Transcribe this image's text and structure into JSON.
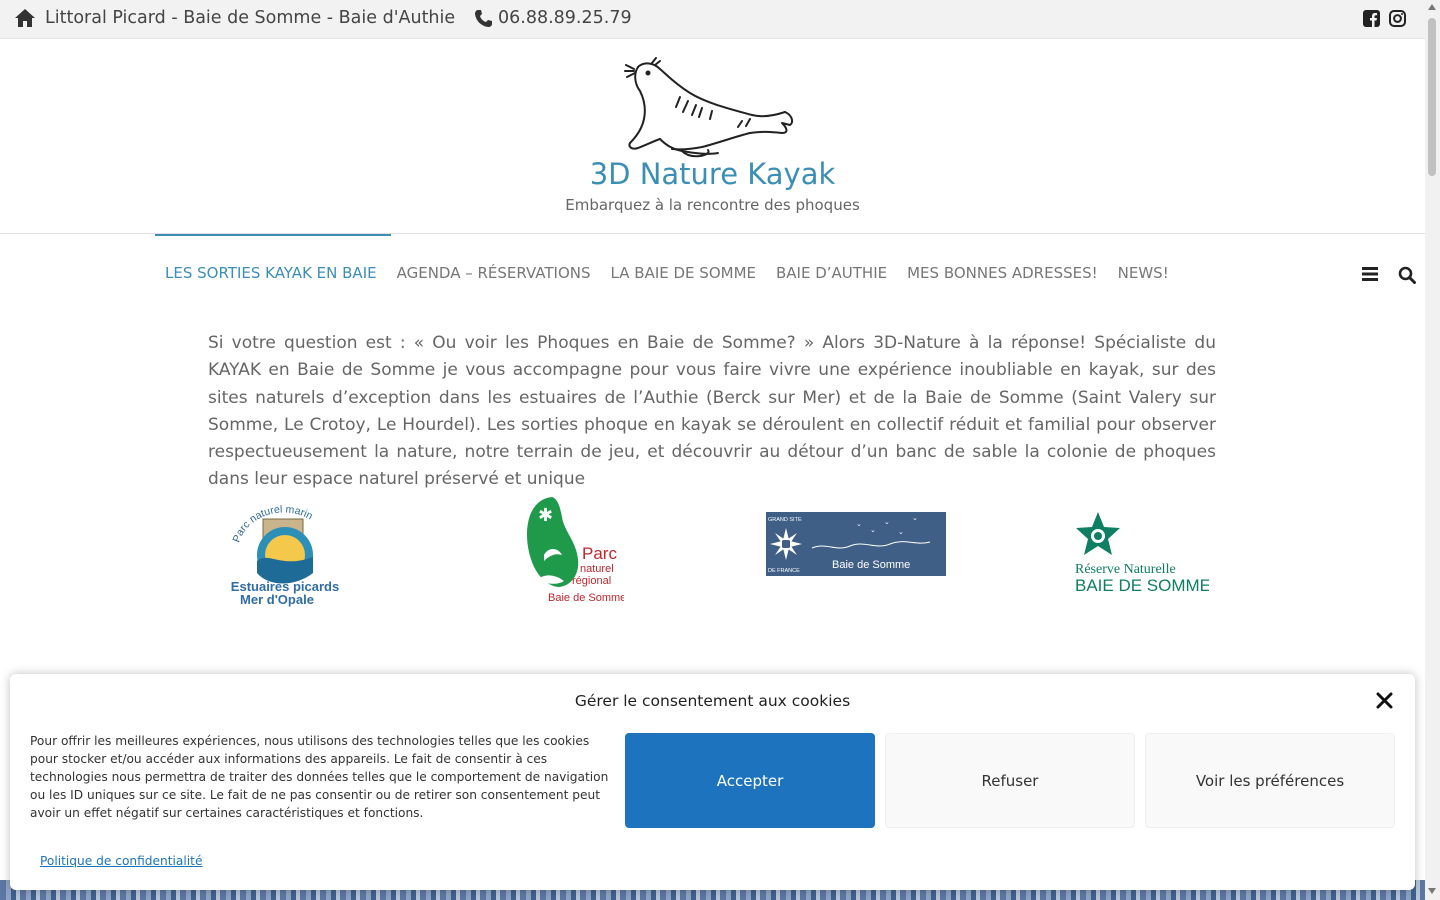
{
  "topbar": {
    "location": "Littoral Picard - Baie de Somme - Baie d'Authie",
    "phone": "06.88.89.25.79",
    "icons": [
      "home-icon",
      "phone-icon",
      "facebook-icon",
      "instagram-icon"
    ]
  },
  "header": {
    "title": "3D Nature Kayak",
    "tagline": "Embarquez à la rencontre des phoques",
    "logo": "seal-logo"
  },
  "nav": {
    "items": [
      {
        "label": "LES SORTIES KAYAK EN BAIE",
        "active": true
      },
      {
        "label": "AGENDA – RÉSERVATIONS",
        "active": false
      },
      {
        "label": "LA BAIE DE SOMME",
        "active": false
      },
      {
        "label": "BAIE D’AUTHIE",
        "active": false
      },
      {
        "label": "MES BONNES ADRESSES!",
        "active": false
      },
      {
        "label": "NEWS!",
        "active": false
      }
    ],
    "icons": [
      "menu-icon",
      "search-icon"
    ]
  },
  "intro": {
    "text": "Si votre question est : « Ou voir les Phoques en Baie de Somme? » Alors 3D-Nature à la réponse! Spécialiste du KAYAK en Baie de Somme je vous accompagne pour vous faire vivre une expérience inoubliable en kayak, sur des  sites naturels d’exception dans les estuaires de l’Authie (Berck sur Mer) et de la Baie de Somme (Saint Valery sur Somme, Le Crotoy, Le Hourdel). Les sorties phoque en kayak se déroulent en collectif réduit et familial pour observer respectueusement la nature, notre terrain de jeu, et découvrir au détour d’un banc de sable la colonie de phoques dans leur espace naturel préservé et unique"
  },
  "partners": {
    "pnm": {
      "arc": "Parc naturel marin",
      "line1": "Estuaires picards",
      "line2": "Mer d'Opale"
    },
    "pnr": {
      "line1": "Parc",
      "line2": "naturel",
      "line3": "régional",
      "line4": "Baie de Somme"
    },
    "grandsite": {
      "small1": "GRAND SITE",
      "small2": "DE FRANCE",
      "name": "Baie de Somme"
    },
    "reserve": {
      "line1": "Réserve Naturelle",
      "line2": "BAIE DE SOMME"
    }
  },
  "cookie": {
    "title": "Gérer le consentement aux cookies",
    "message": "Pour offrir les meilleures expériences, nous utilisons des technologies telles que les cookies pour stocker et/ou accéder aux informations des appareils. Le fait de consentir à ces technologies nous permettra de traiter des données telles que le comportement de navigation ou les ID uniques sur ce site. Le fait de ne pas consentir ou de retirer son consentement peut avoir un effet négatif sur certaines caractéristiques et fonctions.",
    "accept": "Accepter",
    "refuse": "Refuser",
    "preferences": "Voir les préférences",
    "privacy_link": "Politique de confidentialité"
  },
  "colors": {
    "brand": "#3b8fb7",
    "accept_button": "#1e73be",
    "pnr_green": "#1f9a4a",
    "reserve_green": "#0e7f62",
    "grandsite_blue": "#3f5f86"
  }
}
